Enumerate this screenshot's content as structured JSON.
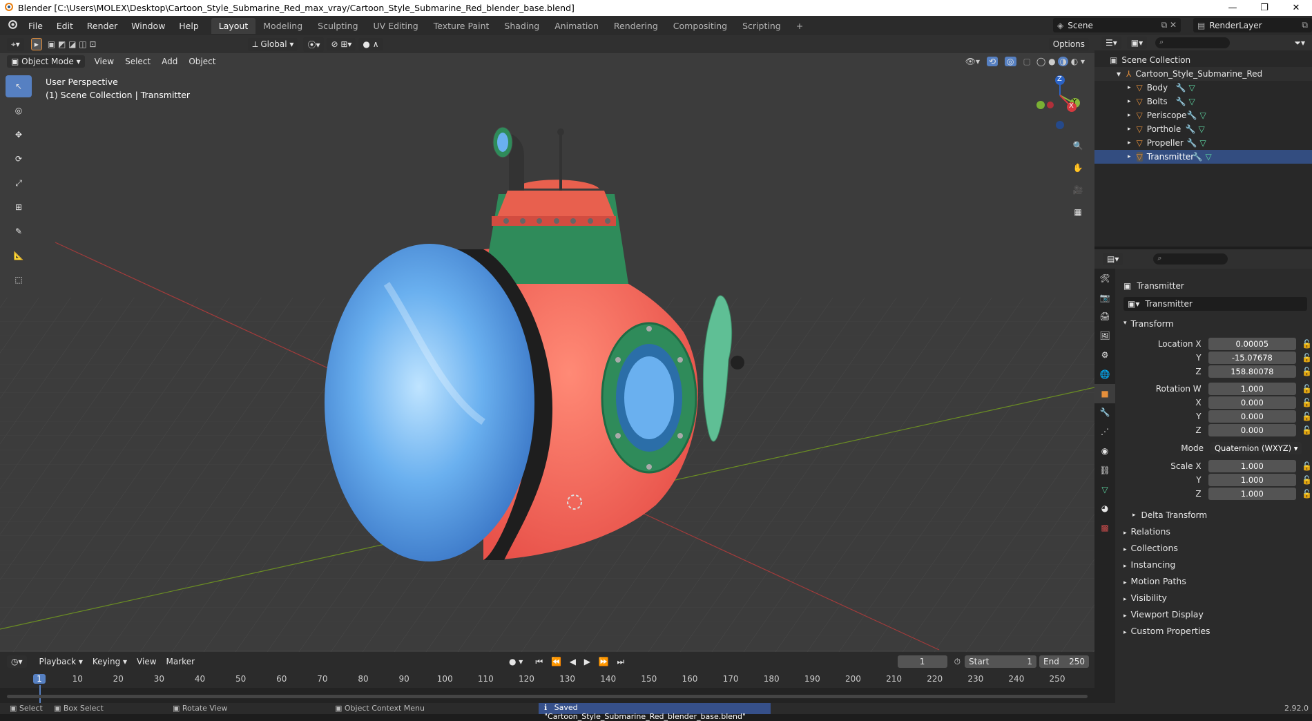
{
  "window": {
    "title": "Blender [C:\\Users\\MOLEX\\Desktop\\Cartoon_Style_Submarine_Red_max_vray/Cartoon_Style_Submarine_Red_blender_base.blend]",
    "minimize": "—",
    "maximize": "❐",
    "close": "✕"
  },
  "menu": {
    "file": "File",
    "edit": "Edit",
    "render": "Render",
    "window": "Window",
    "help": "Help"
  },
  "workspaces": [
    "Layout",
    "Modeling",
    "Sculpting",
    "UV Editing",
    "Texture Paint",
    "Shading",
    "Animation",
    "Rendering",
    "Compositing",
    "Scripting"
  ],
  "scene": {
    "name": "Scene",
    "render_layer": "RenderLayer"
  },
  "viewport": {
    "mode": "Object Mode",
    "menus": [
      "View",
      "Select",
      "Add",
      "Object"
    ],
    "orientation": "Global",
    "options": "Options",
    "perspective": "User Perspective",
    "collection_info": "(1) Scene Collection | Transmitter",
    "gizmo_z": "Z",
    "gizmo_y": "Y",
    "gizmo_x": "X"
  },
  "timeline": {
    "menus": [
      "Playback",
      "Keying",
      "View",
      "Marker"
    ],
    "current_frame": "1",
    "start_label": "Start",
    "start": "1",
    "end_label": "End",
    "end": "250",
    "ticks": [
      "1",
      "10",
      "20",
      "30",
      "40",
      "50",
      "60",
      "70",
      "80",
      "90",
      "100",
      "110",
      "120",
      "130",
      "140",
      "150",
      "160",
      "170",
      "180",
      "190",
      "200",
      "210",
      "220",
      "230",
      "240",
      "250"
    ]
  },
  "statusbar": {
    "select": "Select",
    "box_select": "Box Select",
    "rotate": "Rotate View",
    "context": "Object Context Menu",
    "saved": "Saved \"Cartoon_Style_Submarine_Red_blender_base.blend\"",
    "version": "2.92.0"
  },
  "outliner": {
    "root": "Scene Collection",
    "collection": "Cartoon_Style_Submarine_Red",
    "items": [
      "Body",
      "Bolts",
      "Periscope",
      "Porthole",
      "Propeller",
      "Transmitter"
    ]
  },
  "properties": {
    "object_name": "Transmitter",
    "datablock": "Transmitter",
    "transform_label": "Transform",
    "location": {
      "label": "Location X",
      "x": "0.00005",
      "y": "-15.07678",
      "z": "158.80078"
    },
    "rotation": {
      "label": "Rotation W",
      "w": "1.000",
      "x": "0.000",
      "y": "0.000",
      "z": "0.000"
    },
    "mode_label": "Mode",
    "mode": "Quaternion (WXYZ)",
    "scale": {
      "label": "Scale X",
      "x": "1.000",
      "y": "1.000",
      "z": "1.000"
    },
    "axis_y": "Y",
    "axis_z": "Z",
    "axis_x": "X",
    "delta": "Delta Transform",
    "sections": [
      "Relations",
      "Collections",
      "Instancing",
      "Motion Paths",
      "Visibility",
      "Viewport Display",
      "Custom Properties"
    ]
  },
  "colors": {
    "accent": "#5680c2",
    "orange": "#e58f3b",
    "viewport_bg": "#3c3c3c"
  }
}
